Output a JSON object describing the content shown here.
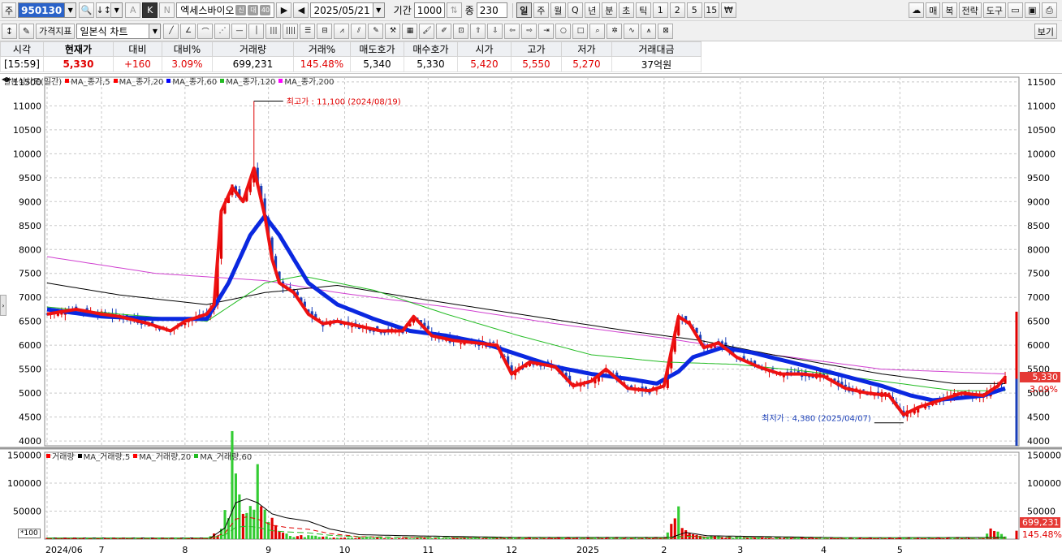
{
  "toolbar1": {
    "market_label": "주",
    "code": "950130",
    "stock_name": "엑세스바이오",
    "stock_tags": [
      "신",
      "대",
      "40"
    ],
    "date": "2025/05/21",
    "period_label": "기간",
    "period_value": "1000",
    "count_label": "종",
    "count_value": "230",
    "k_button": "K",
    "a_button": "A",
    "n_button": "N",
    "intervals": [
      "일",
      "주",
      "월",
      "Q",
      "년",
      "분",
      "초",
      "틱",
      "1",
      "2",
      "5",
      "15"
    ],
    "active_interval": "일",
    "right_buttons": [
      "매",
      "복",
      "전략",
      "도구"
    ]
  },
  "toolbar2": {
    "price_indicator": "가격지표",
    "chart_type": "일본식 차트",
    "view_button": "보기"
  },
  "quote": {
    "headers": [
      "시각",
      "현재가",
      "대비",
      "대비%",
      "거래량",
      "거래%",
      "매도호가",
      "매수호가",
      "시가",
      "고가",
      "저가",
      "거래대금"
    ],
    "values": [
      "[15:59]",
      "5,330",
      "+160",
      "3.09%",
      "699,231",
      "145.48%",
      "5,340",
      "5,330",
      "5,420",
      "5,550",
      "5,270",
      "37억원"
    ]
  },
  "price_legend": [
    {
      "label": "일본식차트(일간)",
      "color": ""
    },
    {
      "label": "MA_종가,5",
      "color": "#ff0000"
    },
    {
      "label": "MA_종가,20",
      "color": "#ff0000"
    },
    {
      "label": "MA_종가,60",
      "color": "#0000ff"
    },
    {
      "label": "MA_종가,120",
      "color": "#22bb22"
    },
    {
      "label": "MA_종가,200",
      "color": "#ff00ff"
    }
  ],
  "volume_legend": [
    {
      "label": "거래량",
      "color": "#ff0000"
    },
    {
      "label": "MA_거래량,5",
      "color": "#000000"
    },
    {
      "label": "MA_거래량,20",
      "color": "#ff0000"
    },
    {
      "label": "MA_거래량,60",
      "color": "#22bb22"
    }
  ],
  "annotations": {
    "high": "최고가 : 11,100 (2024/08/19)",
    "low": "최저가 : 4,380 (2025/04/07)"
  },
  "price_tags": {
    "current": "5,330",
    "change": "3.09%",
    "volume": "699,231",
    "volume_pct": "145.48%",
    "scale": "*100"
  },
  "chart_data": {
    "type": "candlestick",
    "price_axis": {
      "ticks": [
        4000,
        4500,
        5000,
        5500,
        6000,
        6500,
        7000,
        7500,
        8000,
        8500,
        9000,
        9500,
        10000,
        10500,
        11000,
        11500
      ],
      "ylim": [
        3900,
        11600
      ]
    },
    "volume_axis": {
      "ticks": [
        50000,
        100000,
        150000
      ],
      "ylim": [
        0,
        155000
      ]
    },
    "x_labels": [
      "2024/06",
      "7",
      "8",
      "9",
      "10",
      "11",
      "12",
      "2025",
      "2",
      "3",
      "4",
      "5"
    ],
    "x_label_index": [
      0,
      15,
      38,
      61,
      82,
      105,
      128,
      149,
      170,
      191,
      214,
      235
    ],
    "n_days": 265,
    "close_anchors": [
      [
        0,
        6650
      ],
      [
        8,
        6750
      ],
      [
        15,
        6650
      ],
      [
        20,
        6600
      ],
      [
        28,
        6450
      ],
      [
        34,
        6300
      ],
      [
        38,
        6500
      ],
      [
        44,
        6650
      ],
      [
        46,
        6850
      ],
      [
        48,
        8800
      ],
      [
        51,
        9300
      ],
      [
        54,
        9000
      ],
      [
        57,
        9700
      ],
      [
        60,
        8700
      ],
      [
        62,
        7800
      ],
      [
        64,
        7300
      ],
      [
        68,
        7100
      ],
      [
        72,
        6650
      ],
      [
        76,
        6450
      ],
      [
        80,
        6500
      ],
      [
        86,
        6400
      ],
      [
        92,
        6300
      ],
      [
        98,
        6300
      ],
      [
        101,
        6600
      ],
      [
        106,
        6200
      ],
      [
        112,
        6100
      ],
      [
        118,
        6050
      ],
      [
        124,
        6000
      ],
      [
        128,
        5400
      ],
      [
        133,
        5650
      ],
      [
        140,
        5550
      ],
      [
        145,
        5150
      ],
      [
        150,
        5250
      ],
      [
        154,
        5500
      ],
      [
        160,
        5100
      ],
      [
        166,
        5050
      ],
      [
        170,
        5150
      ],
      [
        174,
        6600
      ],
      [
        177,
        6450
      ],
      [
        181,
        5950
      ],
      [
        185,
        6050
      ],
      [
        190,
        5750
      ],
      [
        196,
        5550
      ],
      [
        202,
        5400
      ],
      [
        208,
        5400
      ],
      [
        214,
        5350
      ],
      [
        220,
        5100
      ],
      [
        226,
        5000
      ],
      [
        232,
        4950
      ],
      [
        236,
        4550
      ],
      [
        240,
        4700
      ],
      [
        246,
        4850
      ],
      [
        252,
        5000
      ],
      [
        258,
        4950
      ],
      [
        262,
        5150
      ],
      [
        264,
        5330
      ]
    ],
    "ma60_anchors": [
      [
        0,
        6750
      ],
      [
        15,
        6600
      ],
      [
        30,
        6550
      ],
      [
        44,
        6550
      ],
      [
        50,
        7300
      ],
      [
        56,
        8300
      ],
      [
        60,
        8700
      ],
      [
        64,
        8300
      ],
      [
        72,
        7300
      ],
      [
        80,
        6850
      ],
      [
        90,
        6550
      ],
      [
        100,
        6300
      ],
      [
        110,
        6200
      ],
      [
        120,
        6050
      ],
      [
        130,
        5800
      ],
      [
        140,
        5550
      ],
      [
        150,
        5400
      ],
      [
        160,
        5300
      ],
      [
        168,
        5200
      ],
      [
        174,
        5450
      ],
      [
        178,
        5750
      ],
      [
        186,
        5950
      ],
      [
        194,
        5850
      ],
      [
        202,
        5700
      ],
      [
        210,
        5550
      ],
      [
        220,
        5350
      ],
      [
        230,
        5150
      ],
      [
        238,
        4950
      ],
      [
        244,
        4850
      ],
      [
        252,
        4900
      ],
      [
        258,
        4950
      ],
      [
        264,
        5100
      ]
    ],
    "ma120_anchors": [
      [
        0,
        6800
      ],
      [
        20,
        6650
      ],
      [
        44,
        6500
      ],
      [
        60,
        7300
      ],
      [
        70,
        7450
      ],
      [
        90,
        7150
      ],
      [
        110,
        6650
      ],
      [
        130,
        6200
      ],
      [
        150,
        5800
      ],
      [
        170,
        5650
      ],
      [
        190,
        5600
      ],
      [
        210,
        5450
      ],
      [
        230,
        5250
      ],
      [
        250,
        5050
      ],
      [
        264,
        5050
      ]
    ],
    "ma200_anchors": [
      [
        0,
        7300
      ],
      [
        20,
        7050
      ],
      [
        44,
        6850
      ],
      [
        60,
        7100
      ],
      [
        80,
        7250
      ],
      [
        100,
        7000
      ],
      [
        130,
        6650
      ],
      [
        160,
        6300
      ],
      [
        180,
        6100
      ],
      [
        200,
        5800
      ],
      [
        230,
        5400
      ],
      [
        250,
        5200
      ],
      [
        264,
        5200
      ]
    ],
    "ma200b_anchors": [
      [
        0,
        7850
      ],
      [
        30,
        7500
      ],
      [
        60,
        7350
      ],
      [
        80,
        7100
      ],
      [
        110,
        6800
      ],
      [
        140,
        6450
      ],
      [
        170,
        6150
      ],
      [
        200,
        5800
      ],
      [
        230,
        5500
      ],
      [
        264,
        5400
      ]
    ],
    "volume_anchors": [
      [
        0,
        2000
      ],
      [
        44,
        2000
      ],
      [
        47,
        10000
      ],
      [
        48,
        25000
      ],
      [
        50,
        60000
      ],
      [
        51,
        145000
      ],
      [
        52,
        110000
      ],
      [
        53,
        80000
      ],
      [
        55,
        40000
      ],
      [
        57,
        60000
      ],
      [
        58,
        135000
      ],
      [
        60,
        45000
      ],
      [
        62,
        30000
      ],
      [
        64,
        15000
      ],
      [
        68,
        6000
      ],
      [
        80,
        3000
      ],
      [
        100,
        2000
      ],
      [
        170,
        2000
      ],
      [
        174,
        45000
      ],
      [
        176,
        12000
      ],
      [
        180,
        5000
      ],
      [
        200,
        2000
      ],
      [
        258,
        2000
      ],
      [
        260,
        25000
      ],
      [
        262,
        12000
      ],
      [
        264,
        7000
      ]
    ],
    "vol_ma_anchors": [
      [
        0,
        2000
      ],
      [
        45,
        2000
      ],
      [
        49,
        20000
      ],
      [
        52,
        65000
      ],
      [
        55,
        72000
      ],
      [
        58,
        65000
      ],
      [
        62,
        45000
      ],
      [
        66,
        38000
      ],
      [
        72,
        32000
      ],
      [
        78,
        18000
      ],
      [
        86,
        8000
      ],
      [
        100,
        6000
      ],
      [
        130,
        3000
      ],
      [
        172,
        3000
      ],
      [
        176,
        12000
      ],
      [
        182,
        6000
      ],
      [
        220,
        2500
      ],
      [
        264,
        3000
      ]
    ],
    "annotations": {
      "high": {
        "x": 57,
        "value": 11100
      },
      "low": {
        "x": 236,
        "value": 4380
      }
    }
  }
}
